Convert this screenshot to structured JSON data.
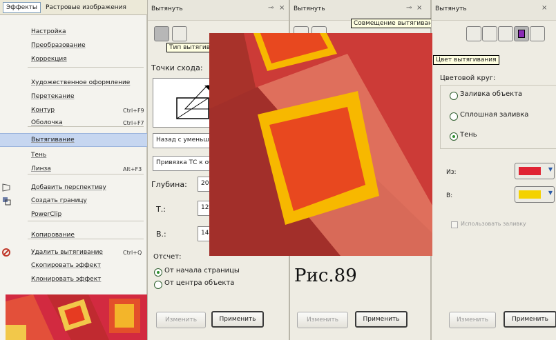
{
  "menu": {
    "tabs": [
      "Эффекты",
      "Растровые изображения"
    ],
    "items": [
      {
        "label": "Настройка",
        "shortcut": ""
      },
      {
        "label": "Преобразование",
        "shortcut": ""
      },
      {
        "label": "Коррекция",
        "shortcut": ""
      },
      {
        "label": "Художественное оформление",
        "shortcut": ""
      },
      {
        "label": "Перетекание",
        "shortcut": ""
      },
      {
        "label": "Контур",
        "shortcut": "Ctrl+F9"
      },
      {
        "label": "Оболочка",
        "shortcut": "Ctrl+F7"
      },
      {
        "label": "Вытягивание",
        "shortcut": ""
      },
      {
        "label": "Тень",
        "shortcut": ""
      },
      {
        "label": "Линза",
        "shortcut": "Alt+F3"
      },
      {
        "label": "Добавить перспективу",
        "shortcut": ""
      },
      {
        "label": "Создать границу",
        "shortcut": ""
      },
      {
        "label": "PowerClip",
        "shortcut": ""
      },
      {
        "label": "Копирование",
        "shortcut": ""
      },
      {
        "label": "Удалить вытягивание",
        "shortcut": "Ctrl+Q"
      },
      {
        "label": "Скопировать эффект",
        "shortcut": ""
      },
      {
        "label": "Клонировать эффект",
        "shortcut": ""
      }
    ]
  },
  "panel1": {
    "title": "Вытянуть",
    "tooltip": "Тип вытягивания",
    "vanish_label": "Точки схода:",
    "vanish_value": "Назад с уменьшением",
    "binding_value": "Привязка ТС к объекту",
    "depth_label": "Глубина:",
    "depth_value": "20",
    "t_label": "Т.:",
    "t_value": "12",
    "v_label": "В.:",
    "v_value": "14",
    "origin_label": "Отсчет:",
    "origin_opt1": "От начала страницы",
    "origin_opt2": "От центра объекта",
    "edit_btn": "Изменить",
    "apply_btn": "Применить"
  },
  "panel2": {
    "title": "Вытянуть",
    "tooltip": "Совмещение вытягивания",
    "edit_btn": "Изменить",
    "apply_btn": "Применить"
  },
  "panel3": {
    "title": "Вытянуть",
    "tooltip": "Цвет вытягивания",
    "color_label": "Цветовой круг:",
    "opt1": "Заливка объекта",
    "opt2": "Сплошная заливка",
    "opt3": "Тень",
    "from_label": "Из:",
    "to_label": "В:",
    "from_color": "#e02434",
    "to_color": "#f4d200",
    "checkbox_label": "Использовать заливку",
    "edit_btn": "Изменить",
    "apply_btn": "Применить"
  },
  "figure": {
    "caption": "Рис.89"
  }
}
